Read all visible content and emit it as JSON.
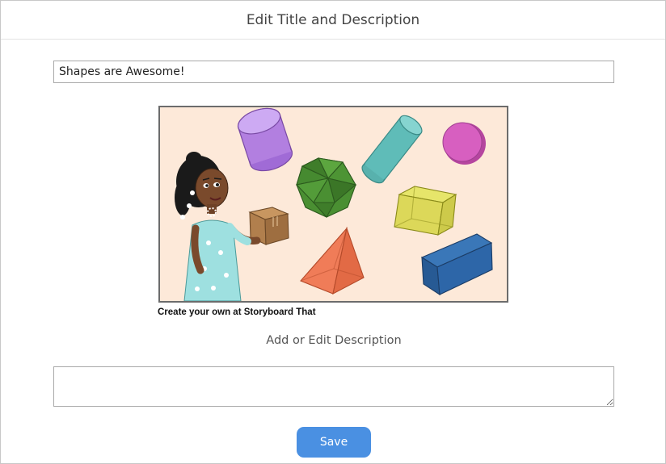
{
  "dialog": {
    "title": "Edit Title and Description"
  },
  "title_field": {
    "value": "Shapes are Awesome!"
  },
  "storyboard": {
    "credit": "Create your own at Storyboard That",
    "shapes": [
      "purple-cylinder",
      "teal-cylinder",
      "pink-sphere",
      "green-icosahedron",
      "yellow-cube",
      "brown-box",
      "orange-pyramid",
      "blue-prism"
    ]
  },
  "description": {
    "label": "Add or Edit Description",
    "value": "",
    "placeholder": ""
  },
  "actions": {
    "save_label": "Save"
  },
  "colors": {
    "accent": "#4a90e2",
    "scene_background": "#fde9d9"
  }
}
